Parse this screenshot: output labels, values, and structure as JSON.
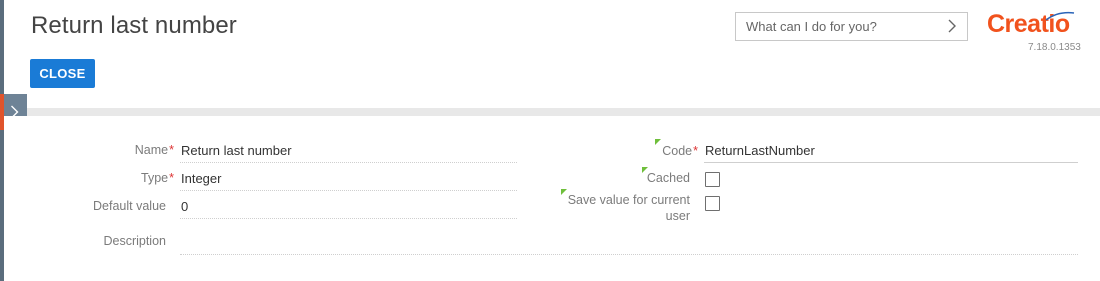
{
  "header": {
    "title": "Return last number",
    "close_label": "CLOSE",
    "search_placeholder": "What can I do for you?",
    "logo_text": "Creatio",
    "version": "7.18.0.1353"
  },
  "form": {
    "name": {
      "label": "Name",
      "value": "Return last number",
      "required": true
    },
    "type": {
      "label": "Type",
      "value": "Integer",
      "required": true
    },
    "default_value": {
      "label": "Default value",
      "value": "0"
    },
    "description": {
      "label": "Description",
      "value": ""
    },
    "code": {
      "label": "Code",
      "value": "ReturnLastNumber",
      "required": true
    },
    "cached": {
      "label": "Cached",
      "checked": false
    },
    "save_value": {
      "label_line1": "Save value for current",
      "label_line2": "user",
      "checked": false
    }
  },
  "colors": {
    "accent": "#1a7bd6",
    "brand": "#f1521d",
    "required": "#dd3333",
    "hint": "#6fbf3b"
  }
}
